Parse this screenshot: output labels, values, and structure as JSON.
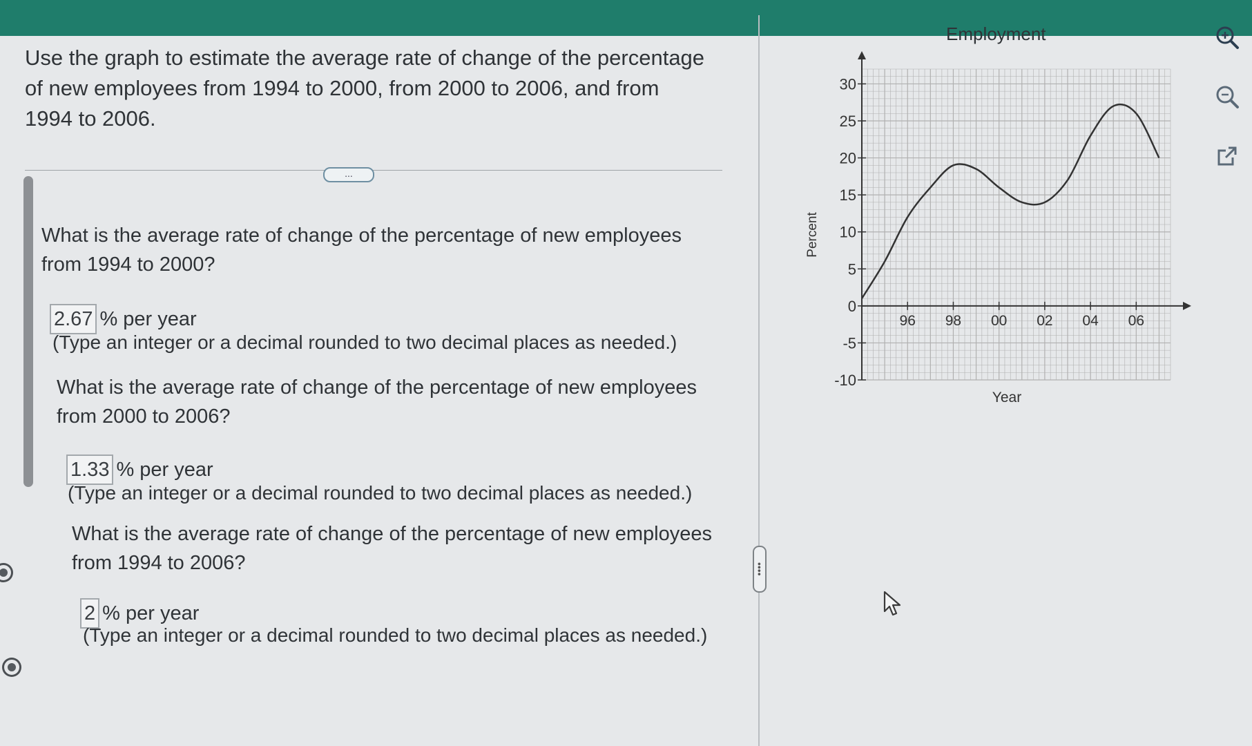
{
  "question": {
    "text": "Use the graph to estimate the average rate of change of the percentage of new employees from 1994 to 2000, from 2000 to 2006, and from 1994 to 2006."
  },
  "more_button_label": "...",
  "parts": [
    {
      "prompt": "What is the average rate of change of the percentage of new employees from 1994 to 2000?",
      "answer": "2.67",
      "unit": "% per year",
      "hint": "(Type an integer or a decimal rounded to two decimal places as needed.)"
    },
    {
      "prompt": "What is the average rate of change of the percentage of new employees from 2000 to 2006?",
      "answer": "1.33",
      "unit": "% per year",
      "hint": "(Type an integer or a decimal rounded to two decimal places as needed.)"
    },
    {
      "prompt": "What is the average rate of change of the percentage of new employees from 1994 to 2006?",
      "answer": "2",
      "unit": "% per year",
      "hint": "(Type an integer or a decimal rounded to two decimal places as needed.)"
    }
  ],
  "chart_data": {
    "type": "line",
    "title": "Employment",
    "xlabel": "Year",
    "ylabel": "Percent",
    "x_tick_labels": [
      "96",
      "98",
      "00",
      "02",
      "04",
      "06"
    ],
    "x_tick_values": [
      1996,
      1998,
      2000,
      2002,
      2004,
      2006
    ],
    "y_tick_labels": [
      "30",
      "25",
      "20",
      "15",
      "10",
      "5",
      "0",
      "-5",
      "-10"
    ],
    "y_tick_values": [
      30,
      25,
      20,
      15,
      10,
      5,
      0,
      -5,
      -10
    ],
    "xlim": [
      1994,
      2007.5
    ],
    "ylim": [
      -10,
      32
    ],
    "grid": true,
    "series": [
      {
        "x": [
          1994,
          1995,
          1996,
          1997,
          1998,
          1999,
          2000,
          2001,
          2002,
          2003,
          2004,
          2005,
          2006,
          2007
        ],
        "y": [
          1,
          6,
          12,
          16,
          19,
          18.5,
          16,
          14,
          14,
          17,
          23,
          27,
          26,
          20
        ]
      }
    ]
  },
  "colors": {
    "topbar": "#1f7d6b",
    "background": "#e6e8ea",
    "curve": "#333333",
    "grid": "#b0b0b0"
  },
  "icons": {
    "zoom_in": "zoom-in-icon",
    "zoom_out": "zoom-out-icon",
    "popout": "external-link-icon",
    "cursor": "pointer-cursor-icon"
  }
}
